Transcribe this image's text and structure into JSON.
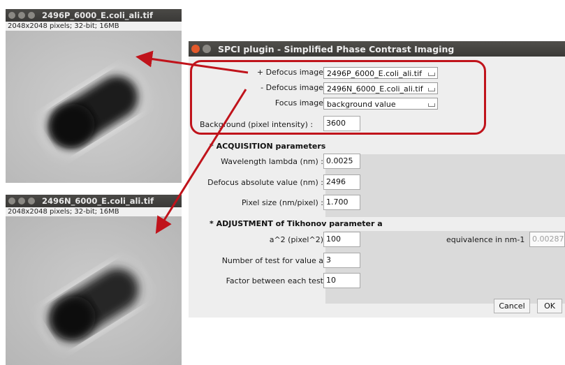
{
  "image_top": {
    "title": "2496P_6000_E.coli_ali.tif",
    "info": "2048x2048 pixels; 32-bit; 16MB"
  },
  "image_bottom": {
    "title": "2496N_6000_E.coli_ali.tif",
    "info": "2048x2048 pixels; 32-bit; 16MB"
  },
  "dialog": {
    "title": "SPCI plugin - Simplified Phase Contrast Imaging",
    "plus_defocus_label": "+ Defocus image",
    "plus_defocus_value": "2496P_6000_E.coli_ali.tif",
    "minus_defocus_label": "- Defocus image",
    "minus_defocus_value": "2496N_6000_E.coli_ali.tif",
    "focus_label": "Focus  image",
    "focus_value": "background value",
    "background_label": "Background (pixel intensity) :",
    "background_value": "3600",
    "acq_heading": "* ACQUISITION  parameters",
    "wavelength_label": "Wavelength lambda (nm) :",
    "wavelength_value": "0.0025",
    "defocus_abs_label": "Defocus absolute value (nm) :",
    "defocus_abs_value": "2496",
    "pixel_size_label": "Pixel size (nm/pixel) :",
    "pixel_size_value": "1.700",
    "adj_heading": "* ADJUSTMENT of Tikhonov parameter  a",
    "a2_label": "a^2 (pixel^2)",
    "a2_value": "100",
    "equiv_label": "equivalence in nm-1",
    "equiv_value": "0.00287",
    "num_test_label": "Number of test for value a",
    "num_test_value": "3",
    "factor_label": "Factor between each test",
    "factor_value": "10",
    "cancel_label": "Cancel",
    "ok_label": "OK"
  },
  "colors": {
    "annotation_red": "#c0131b",
    "close_button": "#e2592a"
  }
}
